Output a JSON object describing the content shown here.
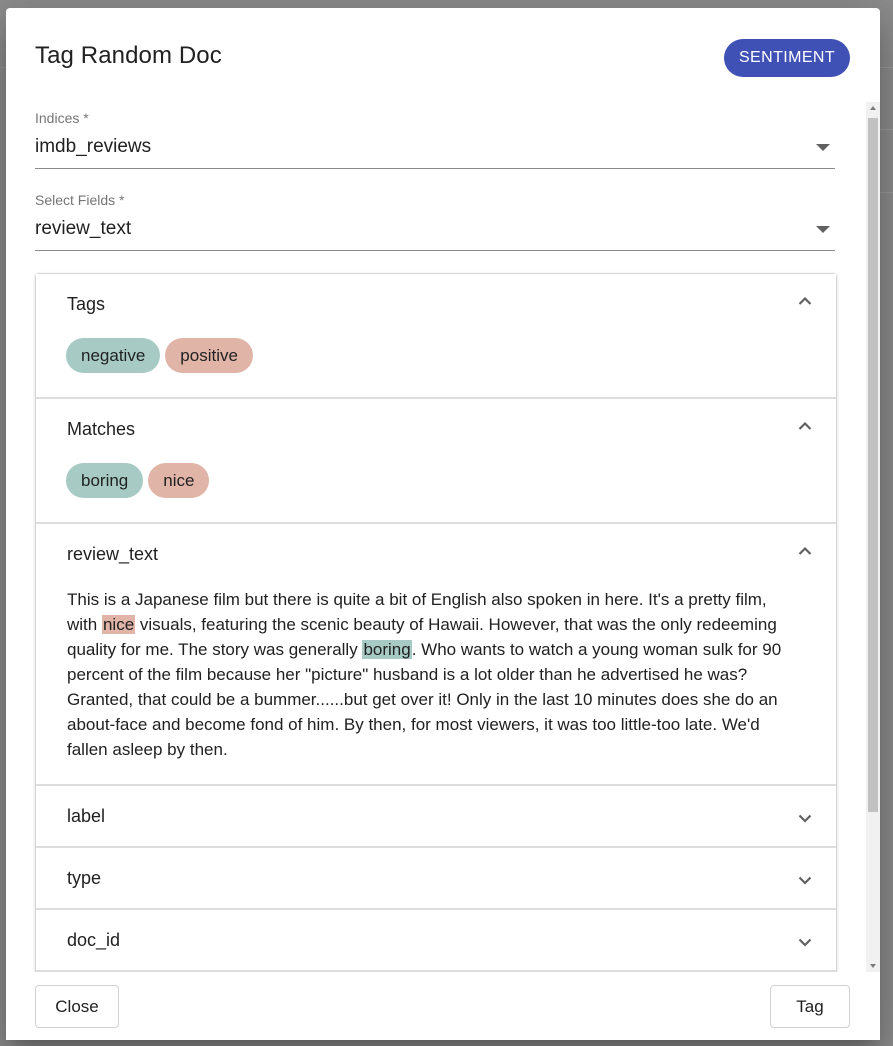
{
  "dialog": {
    "title": "Tag Random Doc",
    "sentiment_button": "SENTIMENT",
    "accent_color": "#3f51b5"
  },
  "fields": {
    "indices": {
      "label": "Indices *",
      "value": "imdb_reviews"
    },
    "select_fields": {
      "label": "Select Fields *",
      "value": "review_text"
    }
  },
  "panels": {
    "tags": {
      "title": "Tags",
      "expanded": true,
      "chips": [
        {
          "label": "negative",
          "color": "#a7cbc4"
        },
        {
          "label": "positive",
          "color": "#e1b4a8"
        }
      ]
    },
    "matches": {
      "title": "Matches",
      "expanded": true,
      "chips": [
        {
          "label": "boring",
          "color": "#a7cbc4"
        },
        {
          "label": "nice",
          "color": "#e1b4a8"
        }
      ]
    },
    "review_text": {
      "title": "review_text",
      "expanded": true,
      "segments": [
        {
          "text": "This is a Japanese film but there is quite a bit of English also spoken in here. It's a pretty film, with "
        },
        {
          "text": "nice",
          "highlight": "#e1b4a8"
        },
        {
          "text": " visuals, featuring the scenic beauty of Hawaii. However, that was the only redeeming quality for me. The story was generally "
        },
        {
          "text": "boring",
          "highlight": "#a7cbc4"
        },
        {
          "text": ". Who wants to watch a young woman sulk for 90 percent of the film because her \"picture\" husband is a lot older than he advertised he was? Granted, that could be a bummer......but get over it! Only in the last 10 minutes does she do an about-face and become fond of him. By then, for most viewers, it was too little-too late. We'd fallen asleep by then."
        }
      ]
    },
    "label": {
      "title": "label",
      "expanded": false
    },
    "type": {
      "title": "type",
      "expanded": false
    },
    "doc_id": {
      "title": "doc_id",
      "expanded": false
    }
  },
  "footer": {
    "close_label": "Close",
    "tag_label": "Tag"
  },
  "icons": {
    "expanded": "chevron-up-icon",
    "collapsed": "chevron-down-icon",
    "select": "dropdown-arrow-icon"
  }
}
